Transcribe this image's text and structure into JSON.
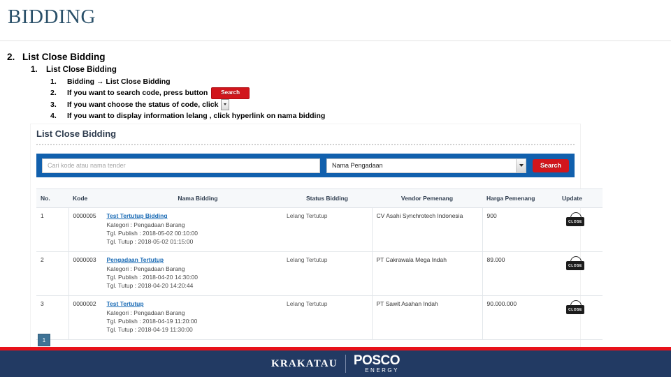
{
  "slide": {
    "title": "BIDDING"
  },
  "outline": {
    "section_num": "2.",
    "section_label": "List Close Bidding",
    "sub_num": "1.",
    "sub_label": "List Close Bidding",
    "steps": [
      {
        "num": "1.",
        "text_before": "Bidding → List Close Bidding",
        "widget": "none",
        "text_after": ""
      },
      {
        "num": "2.",
        "text_before": "If you want to search code, press button",
        "widget": "search-button",
        "widget_label": "Search",
        "text_after": ""
      },
      {
        "num": "3.",
        "text_before": "If you want choose the status of code, click",
        "widget": "caret-button",
        "text_after": ""
      },
      {
        "num": "4.",
        "text_before": "If you want to display information lelang , click hyperlink on nama bidding",
        "widget": "none",
        "text_after": ""
      }
    ]
  },
  "screenshot": {
    "heading": "List Close Bidding",
    "search": {
      "placeholder": "Cari kode atau nama tender",
      "value": "",
      "filter_selected": "Nama Pengadaan",
      "button_label": "Search"
    },
    "table": {
      "headers": [
        "No.",
        "Kode",
        "Nama Bidding",
        "Status Bidding",
        "Vendor Pemenang",
        "Harga Pemenang",
        "Update"
      ],
      "rows": [
        {
          "no": "1",
          "kode": "0000005",
          "nama": "Test Tertutup Bidding",
          "kategori": "Kategori : Pengadaan Barang",
          "tgl_publish": "Tgl. Publish : 2018-05-02 00:10:00",
          "tgl_tutup": "Tgl. Tutup : 2018-05-02 01:15:00",
          "status": "Lelang Tertutup",
          "vendor": "CV Asahi Synchrotech Indonesia",
          "harga": "900",
          "update_badge": "CLOSE"
        },
        {
          "no": "2",
          "kode": "0000003",
          "nama": "Pengadaan Tertutup",
          "kategori": "Kategori : Pengadaan Barang",
          "tgl_publish": "Tgl. Publish : 2018-04-20 14:30:00",
          "tgl_tutup": "Tgl. Tutup : 2018-04-20 14:20:44",
          "status": "Lelang Tertutup",
          "vendor": "PT Cakrawala Mega Indah",
          "harga": "89.000",
          "update_badge": "CLOSE"
        },
        {
          "no": "3",
          "kode": "0000002",
          "nama": "Test Tertutup",
          "kategori": "Kategori : Pengadaan Barang",
          "tgl_publish": "Tgl. Publish : 2018-04-19 11:20:00",
          "tgl_tutup": "Tgl. Tutup : 2018-04-19 11:30:00",
          "status": "Lelang Tertutup",
          "vendor": "PT Sawit Asahan Indah",
          "harga": "90.000.000",
          "update_badge": "CLOSE"
        }
      ]
    },
    "pagination": {
      "current_page": "1"
    }
  },
  "footer": {
    "brand_left": "KRAKATAU",
    "brand_right": "POSCO",
    "brand_right_sub": "ENERGY"
  },
  "colors": {
    "title_blue": "#2a5069",
    "search_bar_blue": "#1160ad",
    "accent_red": "#d1161c",
    "footer_navy": "#223a63",
    "footer_red": "#e8121a",
    "link_blue": "#1a6bb5"
  }
}
